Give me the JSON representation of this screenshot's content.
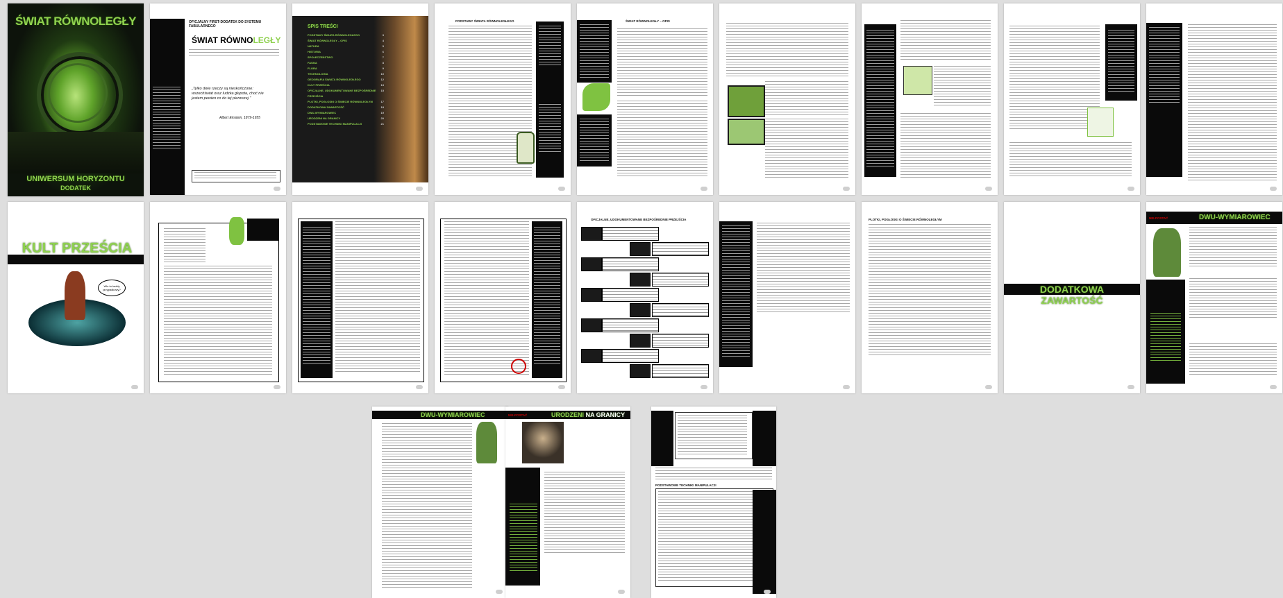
{
  "pages": {
    "p1": {
      "title": "ŚWIAT RÓWNOLEGŁY",
      "subtitle": "UNIWERSUM HORYZONTU",
      "sub2": "DODATEK"
    },
    "p2": {
      "heading": "OFICJALNY FIRST-DODATEK DO SYSTEMU FABULARNEGO",
      "logo1": "ŚWIAT",
      "logo2": "RÓWNO",
      "logo3": "LEGŁY",
      "quote": "„Tylko dwie rzeczy są nieskończone: wszechświat oraz ludzka głupota, choć nie jestem pewien co do tej pierwszej.”",
      "author": "Albert Einstein, 1879-1955"
    },
    "p3": {
      "toc_title": "SPIS TREŚCI",
      "items": [
        "PODSTAWY ŚWIATA RÓWNOLEGŁEGO",
        "ŚWIAT RÓWNOLEGŁY – OPIS",
        "NATURA",
        "HISTORIA",
        "SPOŁECZEŃSTWO",
        "FAUNA",
        "FLORA",
        "TECHNOLOGIA",
        "GEOGRAFIA ŚWIATA RÓWNOLEGŁEGO",
        "KULT PRZEŚCIA",
        "OFICJALNE, UDOKUMENTOWANE BEZPOŚREDNIE PRZEJŚCIA",
        "PLOTKI, POGŁOSKI O ŚWIECIE RÓWNOLEGŁYM",
        "DODATKOWA ZAWARTOŚĆ",
        "DWU-WYMIAROWIEC",
        "URODZENI NA GRANICY",
        "PODSTAWOWE TECHNIKI MANIPULACJI"
      ],
      "nums": [
        "3",
        "4",
        "5",
        "6",
        "7",
        "8",
        "9",
        "10",
        "12",
        "13",
        "15",
        "17",
        "18",
        "19",
        "20",
        "21"
      ]
    },
    "p4": {
      "title": "PODSTAWY ŚWIATA RÓWNOLEGŁEGO"
    },
    "p5": {
      "title": "ŚWIAT RÓWNOLEGŁY – OPIS"
    },
    "p10": {
      "title": "KULT PRZEŚCIA",
      "speech": "Wie to każdy przypadkowy?"
    },
    "p14": {
      "title": "OFICJALNE, UDOKUMENTOWANE BEZPOŚREDNIE PRZEJŚCIA"
    },
    "p16": {
      "title": "PLOTKI, POGŁOSKI O ŚWIECIE RÓWNOLEGŁYM"
    },
    "p17": {
      "title": "DODATKOWA ZAWARTOŚĆ"
    },
    "p18": {
      "title": "DWU-WYMIAROWIEC",
      "tag": "NIE-POSTAĆ"
    },
    "p19": {
      "title": "DWU-WYMIAROWIEC"
    },
    "p20": {
      "title": "URODZENI",
      "title2": "NA GRANICY",
      "tag": "NIE-POSTAĆ"
    },
    "p21": {
      "title": "PODSTAWOWE TECHNIKI MANIPULACJI"
    }
  },
  "colors": {
    "accent": "#8fd14f",
    "dark": "#0a0a0a",
    "background": "#dedede"
  }
}
